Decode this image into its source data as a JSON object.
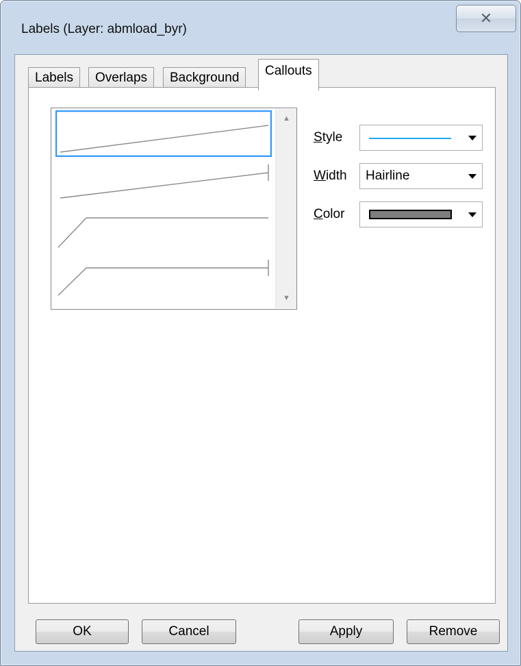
{
  "window": {
    "title": "Labels (Layer: abmload_byr)",
    "close_glyph": "✕"
  },
  "tabs": [
    {
      "label": "Labels",
      "active": false
    },
    {
      "label": "Overlaps",
      "active": false
    },
    {
      "label": "Background",
      "active": false
    },
    {
      "label": "Callouts",
      "active": true
    }
  ],
  "callout_list": {
    "items": [
      {
        "icon": "callout-straight-line-icon",
        "selected": true
      },
      {
        "icon": "callout-straight-line-end-tick-icon",
        "selected": false
      },
      {
        "icon": "callout-bent-line-icon",
        "selected": false
      },
      {
        "icon": "callout-bent-line-end-tick-icon",
        "selected": false
      }
    ],
    "scroll_up_icon": "scroll-up-arrow-icon",
    "scroll_down_icon": "scroll-down-arrow-icon"
  },
  "properties": {
    "style": {
      "label_accel": "S",
      "label_rest": "tyle",
      "value_color": "#1fa6f0"
    },
    "width": {
      "label_accel": "W",
      "label_rest": "idth",
      "value": "Hairline"
    },
    "color": {
      "label_accel": "C",
      "label_rest": "olor",
      "value_color": "#7d7d7d"
    }
  },
  "buttons": {
    "ok": "OK",
    "cancel": "Cancel",
    "apply": "Apply",
    "remove": "Remove"
  }
}
